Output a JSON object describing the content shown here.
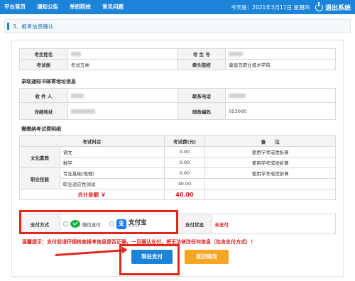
{
  "nav": {
    "items": [
      "平台首页",
      "通知公告",
      "单招院校",
      "常见问题"
    ],
    "date": "今天是：2021年3月11日 星期四",
    "logout": "退出系统"
  },
  "section": {
    "title": "3、报考信息确认"
  },
  "exam_info": {
    "name_label": "考生姓名",
    "id_label": "考 生 号",
    "type_label": "考试类",
    "type_value": "考试五类",
    "school_label": "牵头院校",
    "school_value": "秦皇岛职业技术学院"
  },
  "mail": {
    "title": "录取通知书邮寄地址信息",
    "recipient_label": "收 件 人",
    "phone_label": "联系电话",
    "address_label": "详细地址",
    "postcode_label": "邮政编码",
    "postcode_value": "053000"
  },
  "fees": {
    "title": "需缴纳考试费明细",
    "headers": [
      "考试科目",
      "考试费(元)",
      "备　　注"
    ],
    "groups": [
      {
        "name": "文化素质",
        "rows": [
          {
            "subject": "语文",
            "fee": "0.00",
            "note": "使用学考成绩折算"
          },
          {
            "subject": "数学",
            "fee": "0.00",
            "note": "使用学考成绩折算"
          }
        ]
      },
      {
        "name": "职业技能",
        "rows": [
          {
            "subject": "专业基础(地理)",
            "fee": "0.00",
            "note": "使用学考成绩折算"
          },
          {
            "subject": "职业适应性测试",
            "fee": "40.00",
            "note": ""
          }
        ]
      }
    ],
    "total_label": "合计金额 ￥",
    "total_value": "40.00"
  },
  "payment": {
    "method_label": "支付方式",
    "wechat_label": "微信支付",
    "alipay_label": "支付宝",
    "alipay_sub": "ALIPAY",
    "status_label": "支付状态",
    "status_value": "未支付"
  },
  "warning": "温馨提示：支付前请仔细核查报考信息是否正确，一旦确认支付，将无法修改任何信息（包含支付方式）！",
  "buttons": {
    "pay": "现在支付",
    "back": "返回修改"
  },
  "colors": {
    "primary": "#1b84d8",
    "danger": "#e02020",
    "warning": "#f5a623",
    "wechat": "#22b24c",
    "alipay": "#1677ff"
  }
}
